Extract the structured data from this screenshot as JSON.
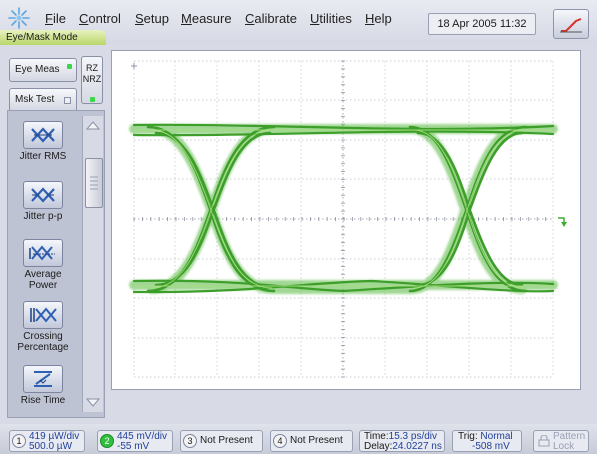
{
  "menu": {
    "items": [
      {
        "u": "F",
        "rest": "ile"
      },
      {
        "u": "C",
        "rest": "ontrol"
      },
      {
        "u": "S",
        "rest": "etup"
      },
      {
        "u": "M",
        "rest": "easure"
      },
      {
        "u": "C",
        "rest": "alibrate"
      },
      {
        "u": "U",
        "rest": "tilities"
      },
      {
        "u": "H",
        "rest": "elp"
      }
    ],
    "datetime": "18 Apr 2005  11:32"
  },
  "mode_tab": "Eye/Mask Mode",
  "left": {
    "eye_meas": "Eye Meas",
    "msk_test": "Msk Test",
    "rz": "RZ",
    "nrz": "NRZ"
  },
  "tools": [
    {
      "label": "Jitter RMS",
      "icon": "jitter-rms-icon"
    },
    {
      "label": "Jitter p-p",
      "icon": "jitter-pp-icon"
    },
    {
      "label": "Average Power",
      "icon": "average-power-icon"
    },
    {
      "label": "Crossing Percentage",
      "icon": "crossing-percentage-icon"
    },
    {
      "label": "Rise Time",
      "icon": "rise-time-icon"
    }
  ],
  "status": {
    "ch1": {
      "num": "1",
      "line1": "419 µW/div",
      "line2": "500.0 µW"
    },
    "ch2": {
      "num": "2",
      "line1": "445 mV/div",
      "line2": "-55 mV"
    },
    "ch3": {
      "num": "3",
      "label": "Not Present"
    },
    "ch4": {
      "num": "4",
      "label": "Not Present"
    },
    "time": {
      "label1": "Time:",
      "value1": "15.3 ps/div",
      "label2": "Delay:",
      "value2": "24.0227 ns"
    },
    "trig": {
      "label1": "Trig:",
      "value1": "Normal",
      "value2": "-508 mV"
    },
    "pattern_lock": {
      "line1": "Pattern",
      "line2": "Lock"
    }
  },
  "colors": {
    "trace": "#3fae32",
    "trace_light": "#8fd46a",
    "accent_green": "#2fbf3d",
    "status_blue": "#1f3f9a"
  }
}
